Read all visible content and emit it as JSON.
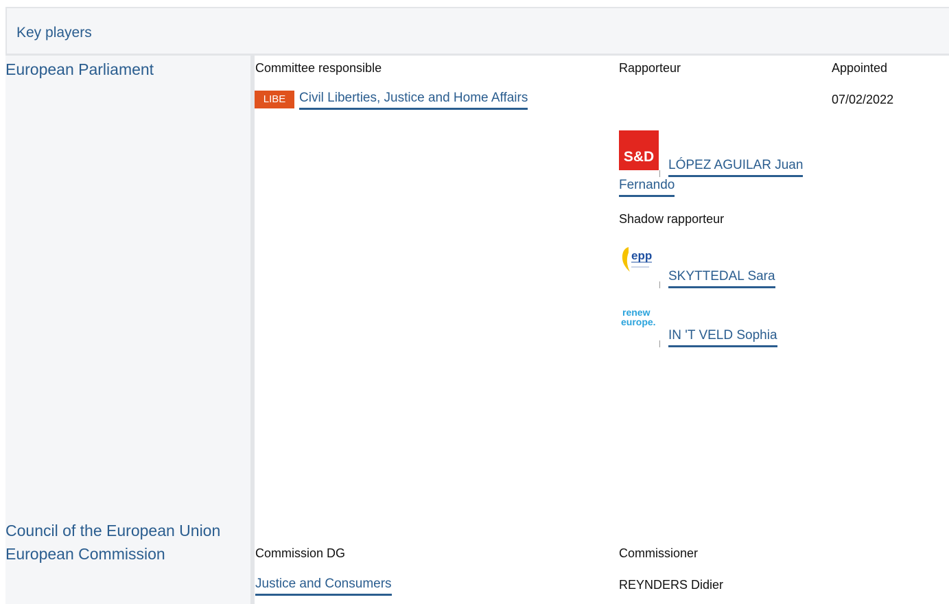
{
  "section_title": "Key players",
  "institutions": {
    "parliament": "European Parliament",
    "council": "Council of the European Union",
    "commission": "European Commission"
  },
  "parliament": {
    "committee_label": "Committee responsible",
    "rapporteur_label": "Rapporteur",
    "appointed_label": "Appointed",
    "committee_code": "LIBE",
    "committee_name": "Civil Liberties, Justice and Home Affairs",
    "appointed_date": "07/02/2022",
    "rapporteur": {
      "group_logo_text": "S&D",
      "name_line1": "LÓPEZ AGUILAR Juan",
      "name_line2": "Fernando"
    },
    "shadow_label": "Shadow rapporteur",
    "shadows": [
      {
        "group_logo_text": "epp",
        "name": "SKYTTEDAL Sara"
      },
      {
        "group_logo_text": "renew europe.",
        "name": "IN 'T VELD Sophia"
      }
    ]
  },
  "commission": {
    "dg_label": "Commission DG",
    "commissioner_label": "Commissioner",
    "dg_name": "Justice and Consumers",
    "commissioner_name": "REYNDERS Didier"
  },
  "colors": {
    "link": "#2a5d8f",
    "committee_badge": "#e0521d",
    "sd_red": "#e2261f",
    "epp_blue": "#1e4fa0",
    "epp_yellow": "#f6c200",
    "renew_blue": "#2aa3dc"
  }
}
